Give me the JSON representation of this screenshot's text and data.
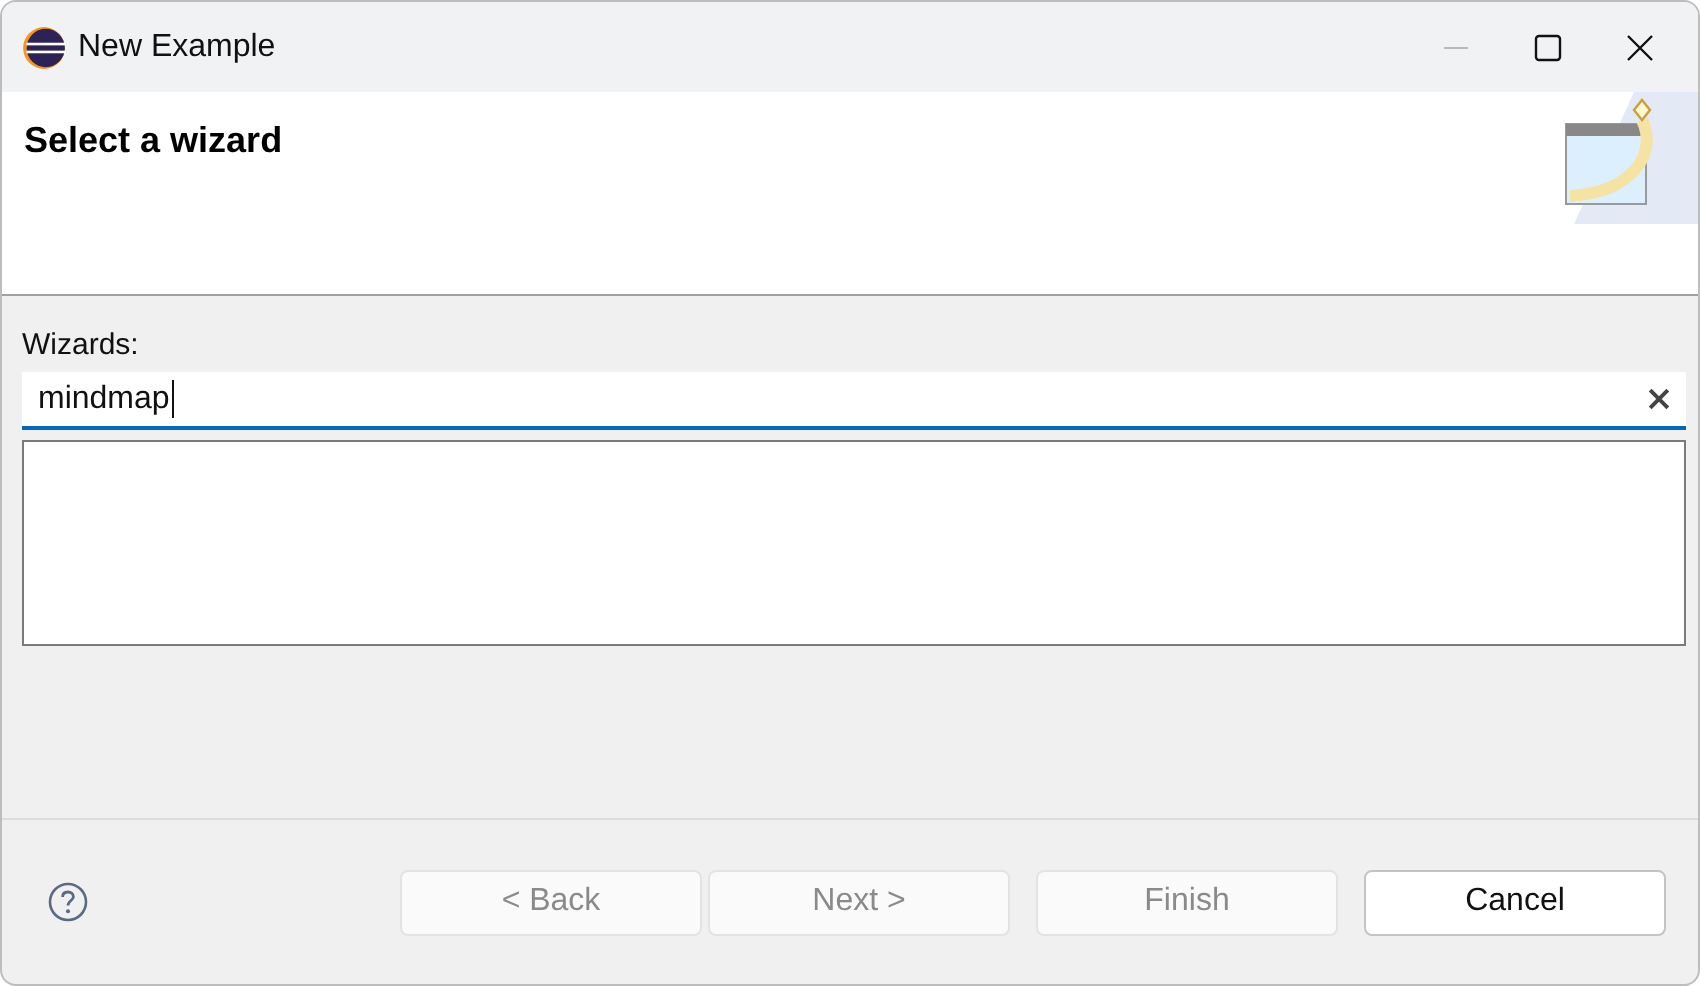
{
  "window": {
    "title": "New Example"
  },
  "header": {
    "title": "Select a wizard"
  },
  "filter": {
    "label": "Wizards:",
    "value": "mindmap",
    "focused": true
  },
  "buttons": [
    {
      "label": "< Back",
      "disabled": true
    },
    {
      "label": "Next >",
      "disabled": true
    },
    {
      "label": "Finish",
      "disabled": true
    },
    {
      "label": "Cancel",
      "disabled": false
    }
  ]
}
